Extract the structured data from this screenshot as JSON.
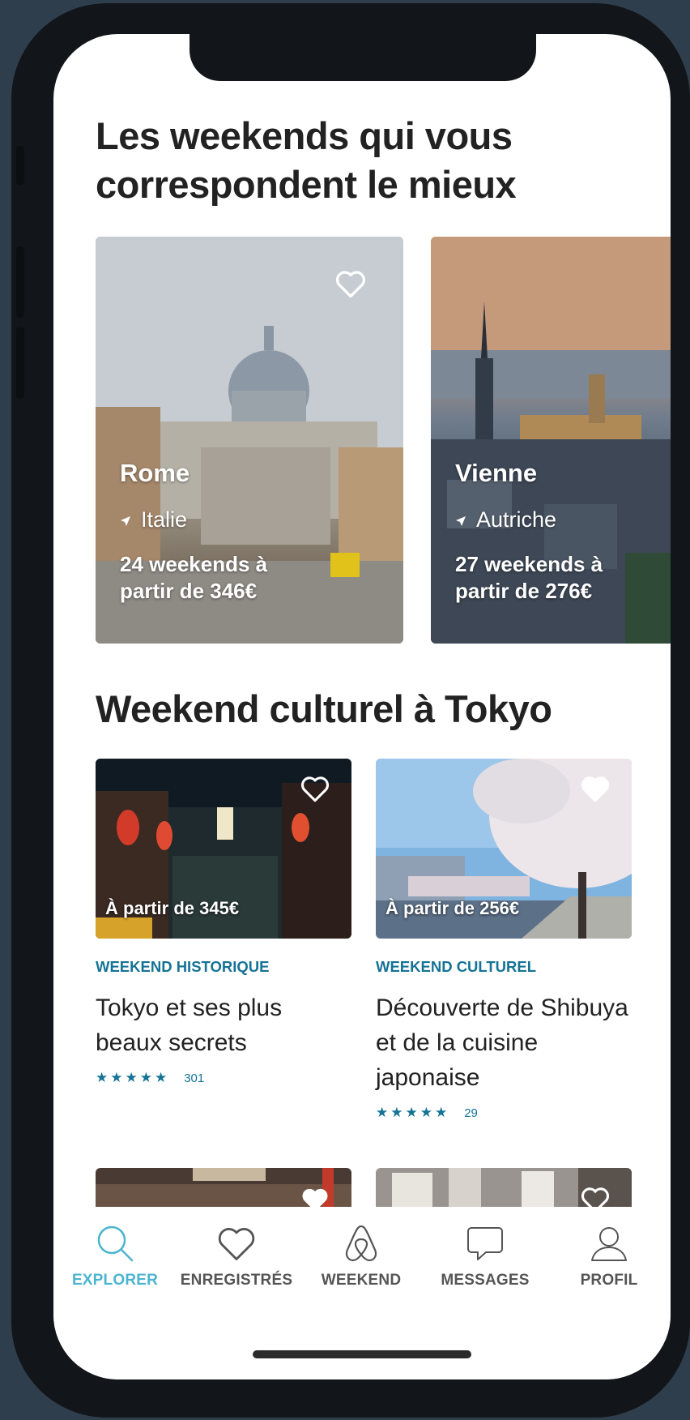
{
  "colors": {
    "accent": "#157396",
    "active_tab": "#4bb5cf",
    "text": "#222222"
  },
  "section_1": {
    "title": "Les weekends qui vous correspondent le mieux"
  },
  "destinations": [
    {
      "name": "Rome",
      "country": "Italie",
      "info": "24 weekends à partir de 346€",
      "icon": "heart-outline-icon"
    },
    {
      "name": "Vienne",
      "country": "Autriche",
      "info": "27 weekends à partir de 276€"
    }
  ],
  "section_2": {
    "title": "Weekend culturel à Tokyo"
  },
  "experiences": [
    {
      "price": "À partir de 345€",
      "category": "WEEKEND HISTORIQUE",
      "title": "Tokyo et ses plus beaux secrets",
      "rating": 5,
      "count": "301",
      "favorite": false
    },
    {
      "price": "À partir de 256€",
      "category": "WEEKEND CULTUREL",
      "title": "Découverte de Shibuya et de la cuisine japonaise",
      "rating": 5,
      "count": "29",
      "favorite": true
    }
  ],
  "tabs": [
    {
      "label": "EXPLORER",
      "icon": "search-icon",
      "active": true
    },
    {
      "label": "ENREGISTRÉS",
      "icon": "heart-icon",
      "active": false
    },
    {
      "label": "WEEKEND",
      "icon": "airbnb-logo-icon",
      "active": false
    },
    {
      "label": "MESSAGES",
      "icon": "message-icon",
      "active": false
    },
    {
      "label": "PROFIL",
      "icon": "profile-icon",
      "active": false
    }
  ]
}
